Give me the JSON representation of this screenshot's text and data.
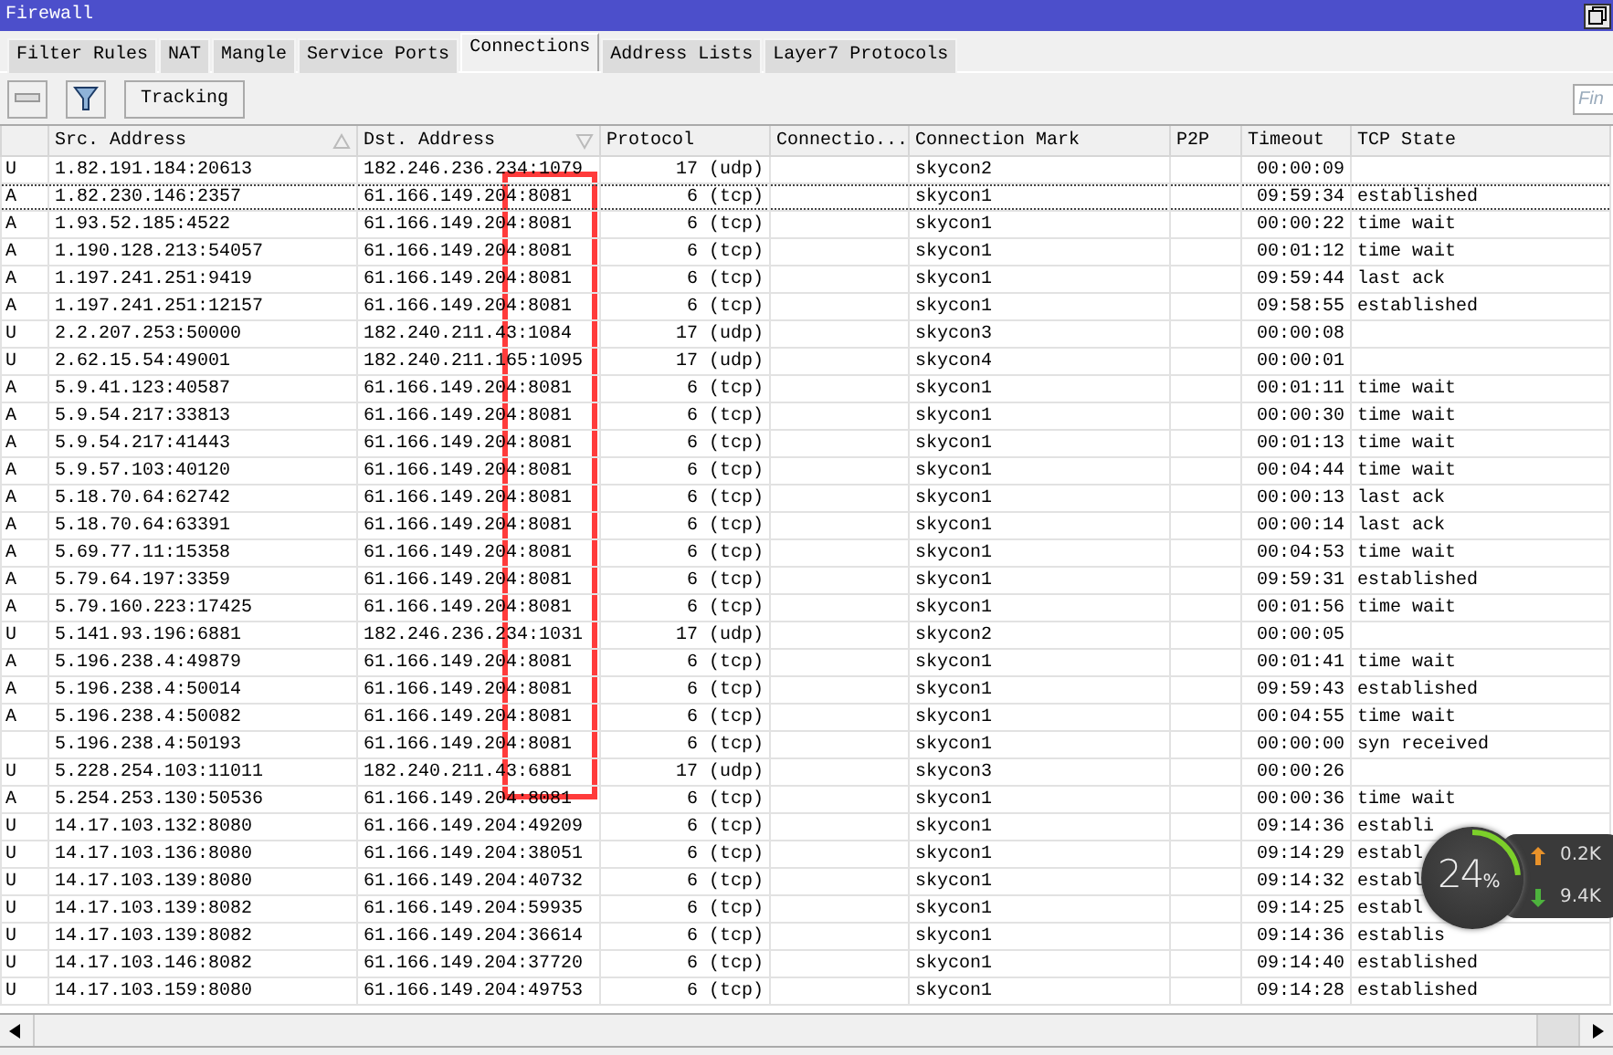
{
  "window": {
    "title": "Firewall"
  },
  "tabs": [
    {
      "label": "Filter Rules",
      "selected": false
    },
    {
      "label": "NAT",
      "selected": false
    },
    {
      "label": "Mangle",
      "selected": false
    },
    {
      "label": "Service Ports",
      "selected": false
    },
    {
      "label": "Connections",
      "selected": true
    },
    {
      "label": "Address Lists",
      "selected": false
    },
    {
      "label": "Layer7 Protocols",
      "selected": false
    }
  ],
  "toolbar": {
    "tracking_button": "Tracking",
    "find": {
      "placeholder": "Fin"
    }
  },
  "table": {
    "columns": [
      {
        "label": "Src. Address",
        "sort_asc": true,
        "sort_desc": false
      },
      {
        "label": "Dst. Address",
        "sort_asc": false,
        "sort_desc": true
      },
      {
        "label": "Protocol",
        "sort_asc": false,
        "sort_desc": false
      },
      {
        "label": "Connectio...",
        "sort_asc": false,
        "sort_desc": false
      },
      {
        "label": "Connection Mark",
        "sort_asc": false,
        "sort_desc": false
      },
      {
        "label": "P2P",
        "sort_asc": false,
        "sort_desc": false
      },
      {
        "label": "Timeout",
        "sort_asc": false,
        "sort_desc": false
      },
      {
        "label": "TCP State",
        "sort_asc": false,
        "sort_desc": false
      }
    ],
    "rows": [
      {
        "flag": "U",
        "src": "1.82.191.184:20613",
        "dst": "182.246.236.234:1079",
        "protocol": "17 (udp)",
        "mark": "skycon2",
        "timeout": "00:00:09",
        "focused": false
      },
      {
        "flag": "A",
        "src": "1.82.230.146:2357",
        "dst": "61.166.149.204:8081",
        "protocol": "6 (tcp)",
        "mark": "skycon1",
        "timeout": "09:59:34",
        "tcp_state": "established",
        "focused": true
      },
      {
        "flag": "A",
        "src": "1.93.52.185:4522",
        "dst": "61.166.149.204:8081",
        "protocol": "6 (tcp)",
        "mark": "skycon1",
        "timeout": "00:00:22",
        "tcp_state": "time wait",
        "focused": false
      },
      {
        "flag": "A",
        "src": "1.190.128.213:54057",
        "dst": "61.166.149.204:8081",
        "protocol": "6 (tcp)",
        "mark": "skycon1",
        "timeout": "00:01:12",
        "tcp_state": "time wait",
        "focused": false
      },
      {
        "flag": "A",
        "src": "1.197.241.251:9419",
        "dst": "61.166.149.204:8081",
        "protocol": "6 (tcp)",
        "mark": "skycon1",
        "timeout": "09:59:44",
        "tcp_state": "last ack",
        "focused": false
      },
      {
        "flag": "A",
        "src": "1.197.241.251:12157",
        "dst": "61.166.149.204:8081",
        "protocol": "6 (tcp)",
        "mark": "skycon1",
        "timeout": "09:58:55",
        "tcp_state": "established",
        "focused": false
      },
      {
        "flag": "U",
        "src": "2.2.207.253:50000",
        "dst": "182.240.211.43:1084",
        "protocol": "17 (udp)",
        "mark": "skycon3",
        "timeout": "00:00:08",
        "focused": false
      },
      {
        "flag": "U",
        "src": "2.62.15.54:49001",
        "dst": "182.240.211.165:1095",
        "protocol": "17 (udp)",
        "mark": "skycon4",
        "timeout": "00:00:01",
        "focused": false
      },
      {
        "flag": "A",
        "src": "5.9.41.123:40587",
        "dst": "61.166.149.204:8081",
        "protocol": "6 (tcp)",
        "mark": "skycon1",
        "timeout": "00:01:11",
        "tcp_state": "time wait",
        "focused": false
      },
      {
        "flag": "A",
        "src": "5.9.54.217:33813",
        "dst": "61.166.149.204:8081",
        "protocol": "6 (tcp)",
        "mark": "skycon1",
        "timeout": "00:00:30",
        "tcp_state": "time wait",
        "focused": false
      },
      {
        "flag": "A",
        "src": "5.9.54.217:41443",
        "dst": "61.166.149.204:8081",
        "protocol": "6 (tcp)",
        "mark": "skycon1",
        "timeout": "00:01:13",
        "tcp_state": "time wait",
        "focused": false
      },
      {
        "flag": "A",
        "src": "5.9.57.103:40120",
        "dst": "61.166.149.204:8081",
        "protocol": "6 (tcp)",
        "mark": "skycon1",
        "timeout": "00:04:44",
        "tcp_state": "time wait",
        "focused": false
      },
      {
        "flag": "A",
        "src": "5.18.70.64:62742",
        "dst": "61.166.149.204:8081",
        "protocol": "6 (tcp)",
        "mark": "skycon1",
        "timeout": "00:00:13",
        "tcp_state": "last ack",
        "focused": false
      },
      {
        "flag": "A",
        "src": "5.18.70.64:63391",
        "dst": "61.166.149.204:8081",
        "protocol": "6 (tcp)",
        "mark": "skycon1",
        "timeout": "00:00:14",
        "tcp_state": "last ack",
        "focused": false
      },
      {
        "flag": "A",
        "src": "5.69.77.11:15358",
        "dst": "61.166.149.204:8081",
        "protocol": "6 (tcp)",
        "mark": "skycon1",
        "timeout": "00:04:53",
        "tcp_state": "time wait",
        "focused": false
      },
      {
        "flag": "A",
        "src": "5.79.64.197:3359",
        "dst": "61.166.149.204:8081",
        "protocol": "6 (tcp)",
        "mark": "skycon1",
        "timeout": "09:59:31",
        "tcp_state": "established",
        "focused": false
      },
      {
        "flag": "A",
        "src": "5.79.160.223:17425",
        "dst": "61.166.149.204:8081",
        "protocol": "6 (tcp)",
        "mark": "skycon1",
        "timeout": "00:01:56",
        "tcp_state": "time wait",
        "focused": false
      },
      {
        "flag": "U",
        "src": "5.141.93.196:6881",
        "dst": "182.246.236.234:1031",
        "protocol": "17 (udp)",
        "mark": "skycon2",
        "timeout": "00:00:05",
        "focused": false
      },
      {
        "flag": "A",
        "src": "5.196.238.4:49879",
        "dst": "61.166.149.204:8081",
        "protocol": "6 (tcp)",
        "mark": "skycon1",
        "timeout": "00:01:41",
        "tcp_state": "time wait",
        "focused": false
      },
      {
        "flag": "A",
        "src": "5.196.238.4:50014",
        "dst": "61.166.149.204:8081",
        "protocol": "6 (tcp)",
        "mark": "skycon1",
        "timeout": "09:59:43",
        "tcp_state": "established",
        "focused": false
      },
      {
        "flag": "A",
        "src": "5.196.238.4:50082",
        "dst": "61.166.149.204:8081",
        "protocol": "6 (tcp)",
        "mark": "skycon1",
        "timeout": "00:04:55",
        "tcp_state": "time wait",
        "focused": false
      },
      {
        "src": "5.196.238.4:50193",
        "dst": "61.166.149.204:8081",
        "protocol": "6 (tcp)",
        "mark": "skycon1",
        "timeout": "00:00:00",
        "tcp_state": "syn received",
        "focused": false
      },
      {
        "flag": "U",
        "src": "5.228.254.103:11011",
        "dst": "182.240.211.43:6881",
        "protocol": "17 (udp)",
        "mark": "skycon3",
        "timeout": "00:00:26",
        "focused": false
      },
      {
        "flag": "A",
        "src": "5.254.253.130:50536",
        "dst": "61.166.149.204:8081",
        "protocol": "6 (tcp)",
        "mark": "skycon1",
        "timeout": "00:00:36",
        "tcp_state": "time wait",
        "focused": false
      },
      {
        "flag": "U",
        "src": "14.17.103.132:8080",
        "dst": "61.166.149.204:49209",
        "protocol": "6 (tcp)",
        "mark": "skycon1",
        "timeout": "09:14:36",
        "tcp_state": "establi",
        "focused": false
      },
      {
        "flag": "U",
        "src": "14.17.103.136:8080",
        "dst": "61.166.149.204:38051",
        "protocol": "6 (tcp)",
        "mark": "skycon1",
        "timeout": "09:14:29",
        "tcp_state": "establ",
        "focused": false
      },
      {
        "flag": "U",
        "src": "14.17.103.139:8080",
        "dst": "61.166.149.204:40732",
        "protocol": "6 (tcp)",
        "mark": "skycon1",
        "timeout": "09:14:32",
        "tcp_state": "establ",
        "focused": false
      },
      {
        "flag": "U",
        "src": "14.17.103.139:8082",
        "dst": "61.166.149.204:59935",
        "protocol": "6 (tcp)",
        "mark": "skycon1",
        "timeout": "09:14:25",
        "tcp_state": "establ",
        "focused": false
      },
      {
        "flag": "U",
        "src": "14.17.103.139:8082",
        "dst": "61.166.149.204:36614",
        "protocol": "6 (tcp)",
        "mark": "skycon1",
        "timeout": "09:14:36",
        "tcp_state": "establis",
        "focused": false
      },
      {
        "flag": "U",
        "src": "14.17.103.146:8082",
        "dst": "61.166.149.204:37720",
        "protocol": "6 (tcp)",
        "mark": "skycon1",
        "timeout": "09:14:40",
        "tcp_state": "established",
        "focused": false
      },
      {
        "flag": "U",
        "src": "14.17.103.159:8080",
        "dst": "61.166.149.204:49753",
        "protocol": "6 (tcp)",
        "mark": "skycon1",
        "timeout": "09:14:28",
        "tcp_state": "established",
        "focused": false
      }
    ]
  },
  "speed_widget": {
    "percent": "24",
    "unit": "%",
    "upload": "0.2K",
    "download": "9.4K"
  }
}
